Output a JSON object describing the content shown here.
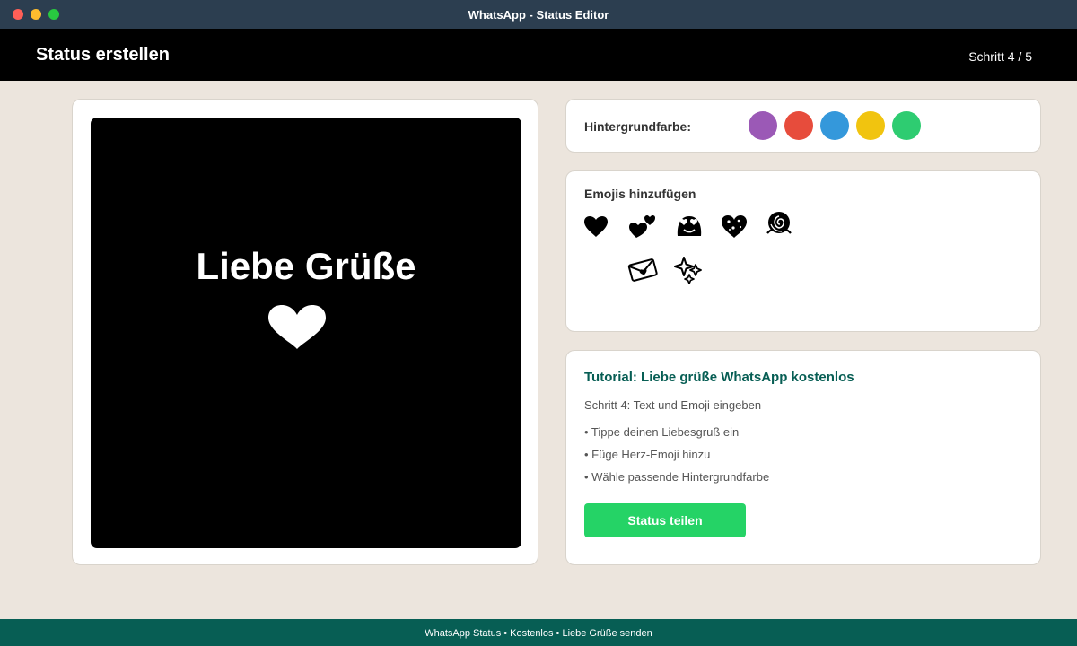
{
  "window": {
    "title": "WhatsApp - Status Editor"
  },
  "header": {
    "title": "Status erstellen",
    "step": "Schritt 4 / 5"
  },
  "preview": {
    "text": "Liebe Grüße",
    "emoji": "heart",
    "background": "#000000",
    "text_color": "#ffffff"
  },
  "background_picker": {
    "label": "Hintergrundfarbe:",
    "colors": [
      "#9b59b6",
      "#e74c3c",
      "#3498db",
      "#f1c40f",
      "#2ecc71"
    ]
  },
  "emoji_picker": {
    "label": "Emojis hinzufügen",
    "emojis": [
      "heavy-heart",
      "heart-decoration",
      "smiling-face-heart-eyes",
      "sparkling-heart",
      "rose",
      "love-letter",
      "sparkles"
    ]
  },
  "tutorial": {
    "title": "Tutorial: Liebe grüße WhatsApp kostenlos",
    "step": "Schritt 4: Text und Emoji eingeben",
    "items": [
      "• Tippe deinen Liebesgruß ein",
      "• Füge Herz-Emoji hinzu",
      "• Wähle passende Hintergrundfarbe"
    ],
    "button": "Status teilen"
  },
  "footer": {
    "text": "WhatsApp Status • Kostenlos • Liebe Grüße senden"
  },
  "colors": {
    "titlebar": "#2c3e50",
    "header": "#000000",
    "accent": "#25d366",
    "brand": "#075e54",
    "page_bg": "#ece5dd"
  }
}
